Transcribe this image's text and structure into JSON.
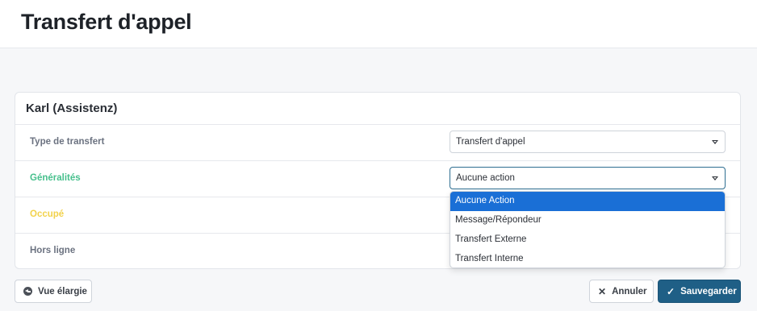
{
  "page": {
    "title": "Transfert d'appel"
  },
  "card": {
    "title": "Karl (Assistenz)",
    "rows": [
      {
        "label": "Type de transfert",
        "select_value": "Transfert d'appel"
      },
      {
        "label": "Généralités",
        "select_value": "Aucune action"
      },
      {
        "label": "Occupé"
      },
      {
        "label": "Hors ligne"
      }
    ]
  },
  "dropdown": {
    "options": [
      "Aucune Action",
      "Message/Répondeur",
      "Transfert Externe",
      "Transfert Interne"
    ],
    "selected": "Aucune Action"
  },
  "footer": {
    "expand_label": "Vue élargie",
    "cancel_label": "Annuler",
    "save_label": "Sauvegarder"
  },
  "colors": {
    "accent": "#1f5f86",
    "selected_option": "#1a6fd6",
    "label_green": "#47c08d",
    "label_yellow": "#f2d24b"
  },
  "icons": {
    "expand": "circle-arrow-left-icon",
    "cancel": "x-icon",
    "save": "check-icon",
    "select_caret": "caret-down-icon"
  }
}
